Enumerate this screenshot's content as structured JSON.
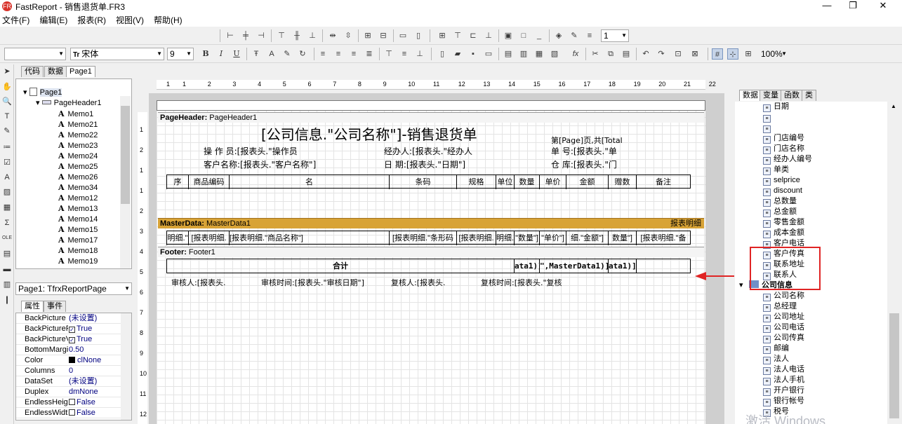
{
  "window": {
    "title": "FastReport - 销售退货单.FR3",
    "logo": "FR",
    "controls": {
      "minimize": "—",
      "maximize": "❐",
      "close": "✕"
    }
  },
  "menu": [
    "文件(F)",
    "编辑(E)",
    "报表(R)",
    "视图(V)",
    "帮助(H)"
  ],
  "toolbar": {
    "style_combo": "",
    "font_combo": "宋体",
    "font_size": "9",
    "bold": "B",
    "italic": "I",
    "underline": "U",
    "line_width": "1",
    "zoom": "100%"
  },
  "editor_tabs": [
    "代码",
    "数据",
    "Page1"
  ],
  "tree": {
    "page": "Page1",
    "header": "PageHeader1",
    "memos": [
      "Memo1",
      "Memo21",
      "Memo22",
      "Memo23",
      "Memo24",
      "Memo25",
      "Memo26",
      "Memo34",
      "Memo12",
      "Memo13",
      "Memo14",
      "Memo15",
      "Memo17",
      "Memo18",
      "Memo19"
    ]
  },
  "inspector": {
    "object": "Page1: TfrxReportPage",
    "tabs": [
      "属性",
      "事件"
    ],
    "properties": [
      {
        "name": "BackPicture",
        "value": "(未设置)",
        "check": false
      },
      {
        "name": "BackPicturePr",
        "value": "True",
        "check": true,
        "checked": true
      },
      {
        "name": "BackPictureVi",
        "value": "True",
        "check": true,
        "checked": true
      },
      {
        "name": "BottomMargin",
        "value": "0.50",
        "check": false
      },
      {
        "name": "Color",
        "value": "clNone",
        "check": false,
        "swatch": "#000000"
      },
      {
        "name": "Columns",
        "value": "0",
        "check": false
      },
      {
        "name": "DataSet",
        "value": "(未设置)",
        "check": false
      },
      {
        "name": "Duplex",
        "value": "dmNone",
        "check": false
      },
      {
        "name": "EndlessHeigh",
        "value": "False",
        "check": true,
        "checked": false
      },
      {
        "name": "EndlessWidth",
        "value": "False",
        "check": true,
        "checked": false
      }
    ]
  },
  "ruler": {
    "top": [
      "1",
      "1",
      "2",
      "3",
      "4",
      "5",
      "6",
      "7",
      "8",
      "9",
      "10",
      "11",
      "12",
      "13",
      "14",
      "15",
      "16",
      "17",
      "18",
      "19",
      "20",
      "21",
      "22"
    ],
    "left": [
      "1",
      "2",
      "1",
      "1",
      "2",
      "3",
      "4",
      "5",
      "6",
      "7",
      "8",
      "9",
      "10",
      "11",
      "12"
    ]
  },
  "report": {
    "page_header_label": "PageHeader:",
    "page_header_name": "PageHeader1",
    "title": "[公司信息.\"公司名称\"]-销售退货单",
    "page_info": "第[Page]页,共[Total",
    "operator": "操 作 员:[报表头.\"操作员",
    "handler": "经办人:[报表头.\"经办人",
    "doc_no": "单 号:[报表头.\"单",
    "customer": "客户名称:[报表头.\"客户名称\"]",
    "date": "日 期:[报表头.\"日期\"]",
    "warehouse": "仓 库:[报表头.\"门",
    "columns": [
      "序",
      "商品编码",
      "名",
      "条码",
      "规格",
      "单位",
      "数量",
      "单价",
      "金额",
      "赠数",
      "备注"
    ],
    "master_label": "MasterData:",
    "master_name": "MasterData1",
    "master_right": "报表明细",
    "detail_cells": [
      "明细.\"",
      "[报表明细.",
      "[报表明细.\"商品名称\"]",
      "[报表明细.\"条形码",
      "[报表明细.",
      "明细.",
      "\"数量\"]",
      "\"单价\"]",
      "细.\"金额\"]",
      "数量\"]",
      "[报表明细.\"备"
    ],
    "footer_label": "Footer:",
    "footer_name": "Footer1",
    "total_label": "合计",
    "total_cells": [
      "ata1)]",
      "\",MasterData1)]",
      "ata1)]"
    ],
    "auditor": "审核人:[报表头.",
    "audit_time": "审核时间:[报表头.\"审核日期\"]",
    "recheck": "复核人:[报表头.",
    "recheck_time": "复核时间:[报表头.\"复核"
  },
  "data_tabs": [
    "数据",
    "变量",
    "函数",
    "类"
  ],
  "data_tree": {
    "fields_top": [
      "日期",
      "",
      "",
      "门店编号",
      "门店名称",
      "经办人编号",
      "单类",
      "selprice",
      "discount",
      "总数量",
      "总金额",
      "零售金额",
      "成本金额",
      "客户电话",
      "客户传真",
      "联系地址",
      "联系人"
    ],
    "group": "公司信息",
    "fields_group": [
      "公司名称",
      "总经理",
      "公司地址",
      "公司电话",
      "公司传真",
      "邮编",
      "法人",
      "法人电话",
      "法人手机",
      "开户银行",
      "银行帐号",
      "税号"
    ]
  },
  "watermark": "激活 Windows",
  "colors": {
    "master_band": "#d8a336",
    "highlight": "#e02424",
    "arrow": "#e02424"
  }
}
